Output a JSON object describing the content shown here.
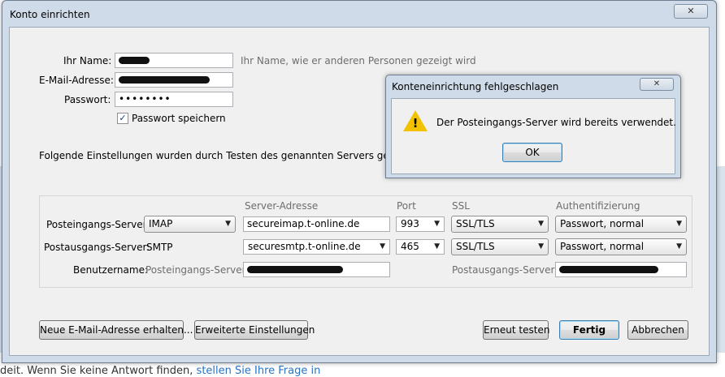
{
  "background": {
    "text_before": "deit. Wenn Sie keine Antwort finden, ",
    "link_text": "stellen Sie Ihre Frage in"
  },
  "window": {
    "title": "Konto einrichten",
    "close_glyph": "✕"
  },
  "account": {
    "name_label": "Ihr Name:",
    "name_hint": "Ihr Name, wie er anderen Personen gezeigt wird",
    "email_label": "E-Mail-Adresse:",
    "password_label": "Passwort:",
    "password_value": "••••••••",
    "remember_checked": true,
    "remember_label": "Passwort speichern",
    "found_text": "Folgende Einstellungen wurden durch Testen des genannten Servers gefunden"
  },
  "server": {
    "headers": {
      "address": "Server-Adresse",
      "port": "Port",
      "ssl": "SSL",
      "auth": "Authentifizierung"
    },
    "incoming": {
      "label": "Posteingangs-Server:",
      "protocol": "IMAP",
      "address": "secureimap.t-online.de",
      "port": "993",
      "ssl": "SSL/TLS",
      "auth": "Passwort, normal"
    },
    "outgoing": {
      "label": "Postausgangs-Server:",
      "protocol": "SMTP",
      "address": "securesmtp.t-online.de",
      "port": "465",
      "ssl": "SSL/TLS",
      "auth": "Passwort, normal"
    },
    "username": {
      "label": "Benutzername:",
      "incoming_label": "Posteingangs-Server:",
      "outgoing_label": "Postausgangs-Server:"
    }
  },
  "buttons": {
    "new_address": "Neue E-Mail-Adresse erhalten...",
    "advanced": "Erweiterte Einstellungen",
    "retest": "Erneut testen",
    "done": "Fertig",
    "cancel": "Abbrechen"
  },
  "error_dialog": {
    "title": "Konteneinrichtung fehlgeschlagen",
    "close_glyph": "✕",
    "icon": "warning-icon",
    "message": "Der Posteingangs-Server wird bereits verwendet.",
    "ok": "OK"
  },
  "colors": {
    "dialog_frame": "#cfdbe8",
    "client_bg": "#f0f0f0",
    "warning": "#f2c200"
  }
}
